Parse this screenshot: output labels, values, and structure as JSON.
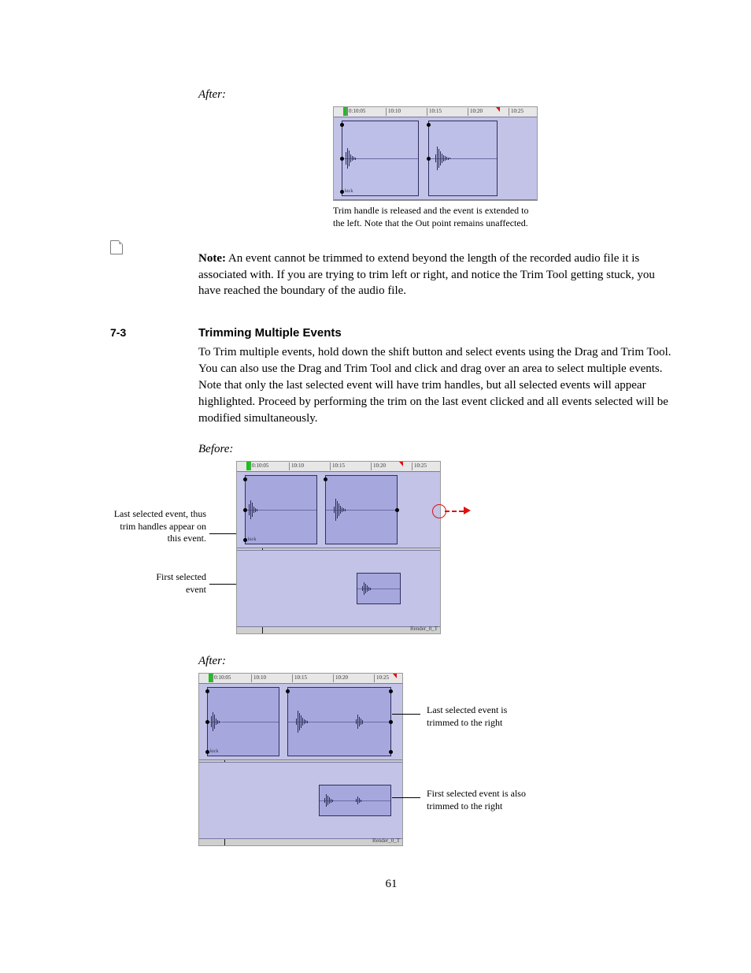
{
  "timeline": {
    "ticks": [
      "0:10:05",
      "10:10",
      "10:15",
      "10:20",
      "10:25"
    ]
  },
  "fig1": {
    "label": "After:",
    "caption": "Trim handle is released and the event is extended to the left. Note that the Out point remains unaffected."
  },
  "note": {
    "bold": "Note:",
    "text": " An event cannot be trimmed to extend beyond the length of the recorded audio file it is associated with. If you are trying to trim left or right, and notice the Trim Tool getting stuck, you have reached the boundary of the audio file."
  },
  "section": {
    "num": "7-3",
    "title": "Trimming Multiple Events"
  },
  "body": "To Trim multiple events, hold down the shift button and select events using the Drag and Trim Tool. You can also use the Drag and Trim Tool and click and drag over an area to select multiple events. Note that only the last selected event will have trim handles, but all selected events will appear highlighted. Proceed by performing the trim on the last event clicked and all events selected will be modified simultaneously.",
  "fig2": {
    "label": "Before:",
    "anno1": "Last selected event, thus trim handles appear on this event.",
    "anno2": "First selected event",
    "footer": "Render_0_T"
  },
  "fig3": {
    "label": "After:",
    "anno1a": "Last selected event is trimmed to the right",
    "anno1b": "",
    "anno2a": "First selected event is also trimmed to the right",
    "anno2b": "",
    "footer": "Render_0_T"
  },
  "pagenum": "61"
}
